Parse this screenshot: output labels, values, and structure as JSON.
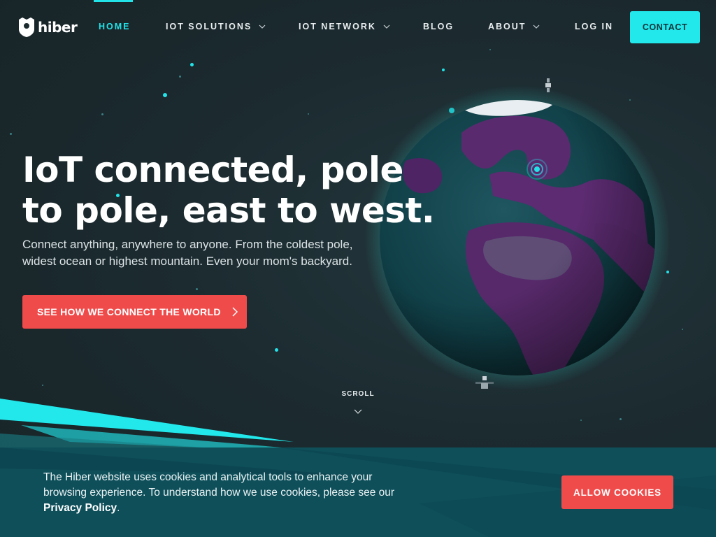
{
  "brand": {
    "name": "hiber"
  },
  "nav": {
    "items": [
      {
        "label": "HOME",
        "active": true,
        "has_dropdown": false
      },
      {
        "label": "IOT SOLUTIONS",
        "active": false,
        "has_dropdown": true
      },
      {
        "label": "IOT NETWORK",
        "active": false,
        "has_dropdown": true
      },
      {
        "label": "BLOG",
        "active": false,
        "has_dropdown": false
      },
      {
        "label": "ABOUT",
        "active": false,
        "has_dropdown": true
      },
      {
        "label": "LOG IN",
        "active": false,
        "has_dropdown": false
      }
    ],
    "contact_label": "CONTACT"
  },
  "hero": {
    "headline": "IoT connected, pole to pole, east to west.",
    "subtext": "Connect anything, anywhere to anyone. From the coldest pole, widest ocean or highest mountain. Even your mom's backyard.",
    "cta_label": "SEE HOW WE CONNECT THE WORLD",
    "scroll_label": "SCROLL"
  },
  "cookie_banner": {
    "text_before_link": "The Hiber website uses cookies and analytical tools to enhance your browsing experience. To understand how we use cookies, please see our ",
    "link_label": "Privacy Policy",
    "text_after_link": ".",
    "button_label": "ALLOW COOKIES"
  },
  "colors": {
    "accent_cyan": "#22e3e8",
    "cta_red": "#f04b4b",
    "background": "#1b2a2e",
    "cookie_bar": "#0e4f5a",
    "globe_purple": "#5a2a6e"
  }
}
